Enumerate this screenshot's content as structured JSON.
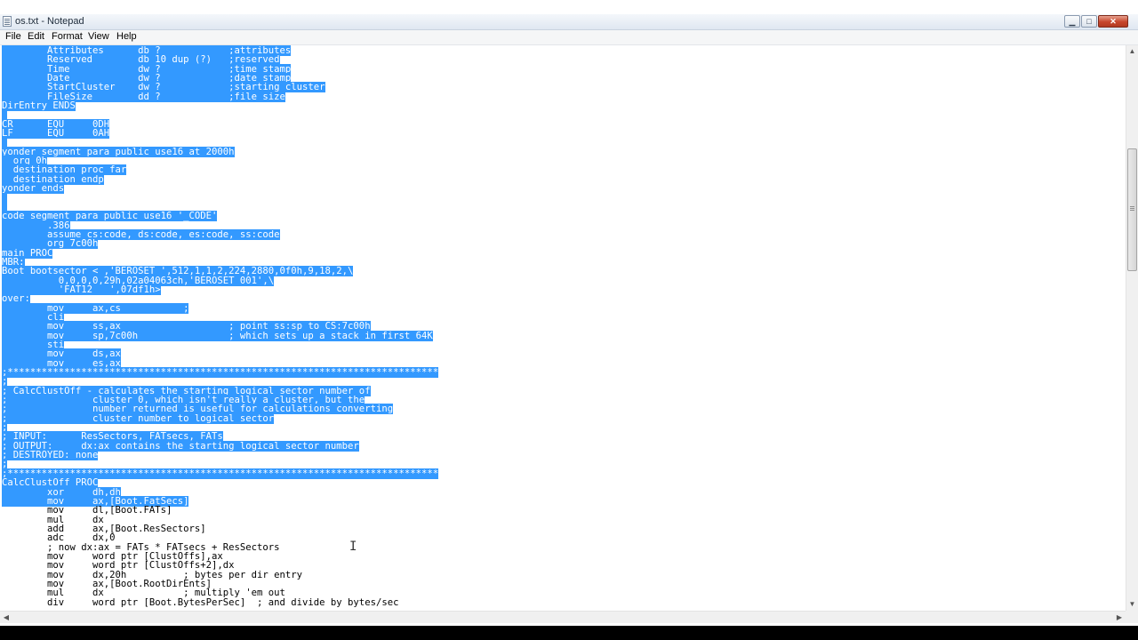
{
  "window": {
    "title": "os.txt - Notepad",
    "minimize_glyph": "▁",
    "maximize_glyph": "□",
    "close_glyph": "✕",
    "icon": "notepad-icon"
  },
  "menu": [
    {
      "label": "File"
    },
    {
      "label": "Edit"
    },
    {
      "label": "Format"
    },
    {
      "label": "View"
    },
    {
      "label": "Help"
    }
  ],
  "scrollbar": {
    "up_glyph": "▲",
    "down_glyph": "▼",
    "left_glyph": "◀",
    "right_glyph": "▶"
  },
  "cursor_glyph": "I",
  "colors": {
    "selection": "#3399ff",
    "selection_text": "#ffffff",
    "editor_bg": "#ffffff"
  },
  "editor": {
    "lines": [
      {
        "text": "        Attributes      db ?            ;attributes",
        "sel": true
      },
      {
        "text": "        Reserved        db 10 dup (?)   ;reserved",
        "sel": true
      },
      {
        "text": "        Time            dw ?            ;time stamp",
        "sel": true
      },
      {
        "text": "        Date            dw ?            ;date stamp",
        "sel": true
      },
      {
        "text": "        StartCluster    dw ?            ;starting cluster",
        "sel": true
      },
      {
        "text": "        FileSize        dd ?            ;file size",
        "sel": true
      },
      {
        "text": "DirEntry ENDS",
        "sel": true
      },
      {
        "text": "",
        "sel": true
      },
      {
        "text": "CR      EQU     0DH",
        "sel": true
      },
      {
        "text": "LF      EQU     0AH",
        "sel": true
      },
      {
        "text": "",
        "sel": true
      },
      {
        "text": "yonder segment para public use16 at 2000h",
        "sel": true
      },
      {
        "text": "  org 0h",
        "sel": true
      },
      {
        "text": "  destination proc far",
        "sel": true
      },
      {
        "text": "  destination endp",
        "sel": true
      },
      {
        "text": "yonder ends",
        "sel": true
      },
      {
        "text": "",
        "sel": true
      },
      {
        "text": "",
        "sel": true
      },
      {
        "text": "code segment para public use16 '_CODE'",
        "sel": true
      },
      {
        "text": "        .386",
        "sel": true
      },
      {
        "text": "        assume cs:code, ds:code, es:code, ss:code",
        "sel": true
      },
      {
        "text": "        org 7c00h",
        "sel": true
      },
      {
        "text": "main PROC",
        "sel": true
      },
      {
        "text": "MBR:",
        "sel": true
      },
      {
        "text": "Boot bootsector < ,'BEROSET ',512,1,1,2,224,2880,0f0h,9,18,2,\\",
        "sel": true
      },
      {
        "text": "          0,0,0,0,29h,02a04063ch,'BEROSET 001',\\",
        "sel": true
      },
      {
        "text": "          'FAT12   ',07df1h>",
        "sel": true
      },
      {
        "text": "over:",
        "sel": true
      },
      {
        "text": "        mov     ax,cs           ;",
        "sel": true
      },
      {
        "text": "        cli",
        "sel": true
      },
      {
        "text": "        mov     ss,ax                   ; point ss:sp to CS:7c00h",
        "sel": true
      },
      {
        "text": "        mov     sp,7c00h                ; which sets up a stack in first 64K",
        "sel": true
      },
      {
        "text": "        sti",
        "sel": true
      },
      {
        "text": "        mov     ds,ax",
        "sel": true
      },
      {
        "text": "        mov     es,ax",
        "sel": true
      },
      {
        "text": ";****************************************************************************",
        "sel": true
      },
      {
        "text": ";",
        "sel": true
      },
      {
        "text": "; CalcClustOff - calculates the starting logical sector number of",
        "sel": true
      },
      {
        "text": ";               cluster 0, which isn't really a cluster, but the",
        "sel": true
      },
      {
        "text": ";               number returned is useful for calculations converting",
        "sel": true
      },
      {
        "text": ";               cluster number to logical sector",
        "sel": true
      },
      {
        "text": ";",
        "sel": true
      },
      {
        "text": "; INPUT:      ResSectors, FATsecs, FATs",
        "sel": true
      },
      {
        "text": "; OUTPUT:     dx:ax contains the starting logical sector number",
        "sel": true
      },
      {
        "text": "; DESTROYED: none",
        "sel": true
      },
      {
        "text": ";",
        "sel": true
      },
      {
        "text": ";****************************************************************************",
        "sel": true
      },
      {
        "text": "CalcClustOff PROC",
        "sel": true
      },
      {
        "text": "        xor     dh,dh",
        "sel": true
      },
      {
        "text": "        mov     ax,[Boot.FatSecs]",
        "sel": true
      },
      {
        "text": "        mov     dl,[Boot.FATs]",
        "sel": false
      },
      {
        "text": "        mul     dx",
        "sel": false
      },
      {
        "text": "        add     ax,[Boot.ResSectors]",
        "sel": false
      },
      {
        "text": "        adc     dx,0",
        "sel": false
      },
      {
        "text": "        ; now dx:ax = FATs * FATsecs + ResSectors",
        "sel": false
      },
      {
        "text": "        mov     word ptr [ClustOffs],ax",
        "sel": false
      },
      {
        "text": "        mov     word ptr [ClustOffs+2],dx",
        "sel": false
      },
      {
        "text": "        mov     dx,20h          ; bytes per dir entry",
        "sel": false
      },
      {
        "text": "        mov     ax,[Boot.RootDirEnts]",
        "sel": false
      },
      {
        "text": "        mul     dx              ; multiply 'em out",
        "sel": false
      },
      {
        "text": "        div     word ptr [Boot.BytesPerSec]  ; and divide by bytes/sec",
        "sel": false
      }
    ]
  }
}
